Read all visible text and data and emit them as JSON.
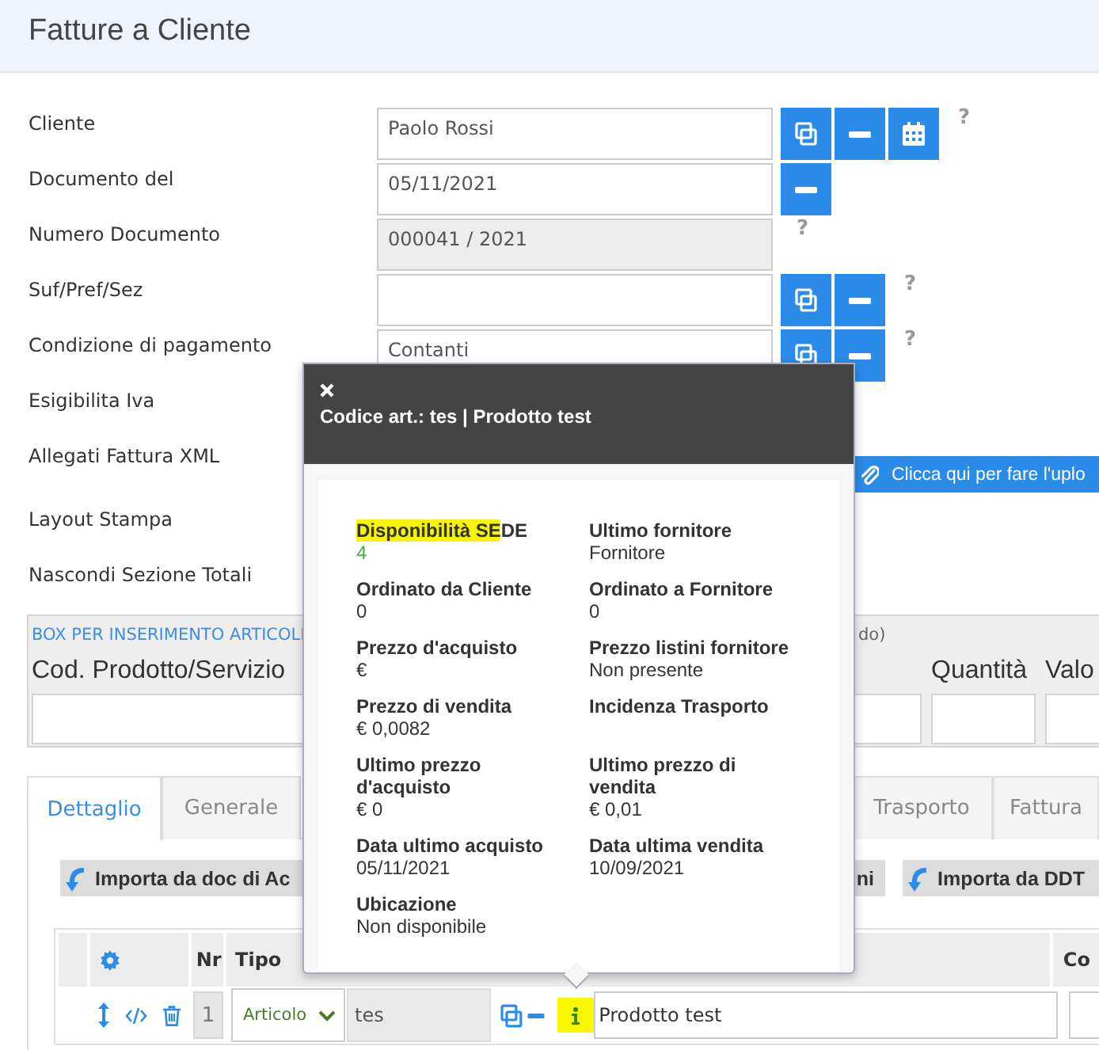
{
  "page_title": "Fatture a Cliente",
  "form_rows": [
    {
      "kind": "field",
      "label": "Cliente",
      "value": "Paolo Rossi",
      "readonly": false,
      "buttons": [
        {
          "kind": "copy"
        },
        {
          "kind": "minus"
        },
        {
          "kind": "calendar"
        }
      ],
      "help": "?"
    },
    {
      "kind": "field",
      "label": "Documento del",
      "value": "05/11/2021",
      "readonly": false,
      "buttons": [
        {
          "kind": "minus"
        }
      ]
    },
    {
      "kind": "field",
      "label": "Numero Documento",
      "value": "000041 / 2021",
      "readonly": true,
      "buttons": [],
      "help": "?"
    },
    {
      "kind": "field",
      "label": "Suf/Pref/Sez",
      "readonly": false,
      "buttons": [
        {
          "kind": "copy"
        },
        {
          "kind": "minus"
        }
      ],
      "help": "?"
    },
    {
      "kind": "field",
      "label": "Condizione di pagamento",
      "value": "Contanti",
      "readonly": false,
      "buttons": [
        {
          "kind": "copy"
        },
        {
          "kind": "minus"
        }
      ],
      "help": "?"
    },
    {
      "kind": "label",
      "label": "Esigibilita Iva"
    },
    {
      "kind": "upload",
      "label": "Allegati Fattura XML",
      "upload_button": "Clicca qui per fare l'uplo"
    },
    {
      "kind": "label",
      "label": "Layout Stampa"
    },
    {
      "kind": "label",
      "label": "Nascondi Sezione Totali"
    }
  ],
  "articles_box": {
    "title": "BOX PER INSERIMENTO ARTICOLI",
    "title_end": "do)",
    "columns": [
      "Cod. Prodotto/Servizio",
      "Quantità",
      "Valo"
    ]
  },
  "tabs": [
    {
      "label": "Dettaglio",
      "selected": true
    },
    {
      "label": "Generale",
      "selected": false
    },
    {
      "label": "Trasporto",
      "selected": false
    },
    {
      "label": "Fattura",
      "selected": false
    }
  ],
  "import_buttons": [
    {
      "label": "Importa da doc di Ac",
      "icon": true
    },
    {
      "label": "ni",
      "icon": false
    },
    {
      "label": "Importa da DDT",
      "icon": true
    }
  ],
  "lines_table": {
    "columns": [
      "Nr",
      "Tipo",
      "Co"
    ],
    "rows": [
      {
        "nr": "1",
        "tipo": "Articolo",
        "codice": "tes",
        "descrizione": "Prodotto test",
        "info_highlighted": true
      }
    ]
  },
  "popover": {
    "title": "Codice art.: tes | Prodotto test",
    "items": [
      {
        "label": "Disponibilità SEDE",
        "value": "4",
        "highlighted": true,
        "color": "#3cb43c"
      },
      {
        "label": "Ultimo fornitore",
        "value": "Fornitore",
        "highlighted": false
      },
      {
        "label": "Ordinato da Cliente",
        "value": "0",
        "highlighted": false
      },
      {
        "label": "Ordinato a Fornitore",
        "value": "0",
        "highlighted": false
      },
      {
        "label": "Prezzo d'acquisto",
        "value": "€",
        "highlighted": false
      },
      {
        "label": "Prezzo listini fornitore",
        "value": "Non presente",
        "highlighted": false
      },
      {
        "label": "Prezzo di vendita",
        "value": "€ 0,0082",
        "highlighted": false
      },
      {
        "label": "Incidenza Trasporto",
        "highlighted": false
      },
      {
        "label": "Ultimo prezzo d'acquisto",
        "value": "€ 0",
        "highlighted": false
      },
      {
        "label": "Ultimo prezzo di vendita",
        "value": "€ 0,01",
        "highlighted": false
      },
      {
        "label": "Data ultimo acquisto",
        "value": "05/11/2021",
        "highlighted": false
      },
      {
        "label": "Data ultima vendita",
        "value": "10/09/2021",
        "highlighted": false
      },
      {
        "label": "Ubicazione",
        "value": "Non disponibile",
        "highlighted": false
      }
    ]
  }
}
